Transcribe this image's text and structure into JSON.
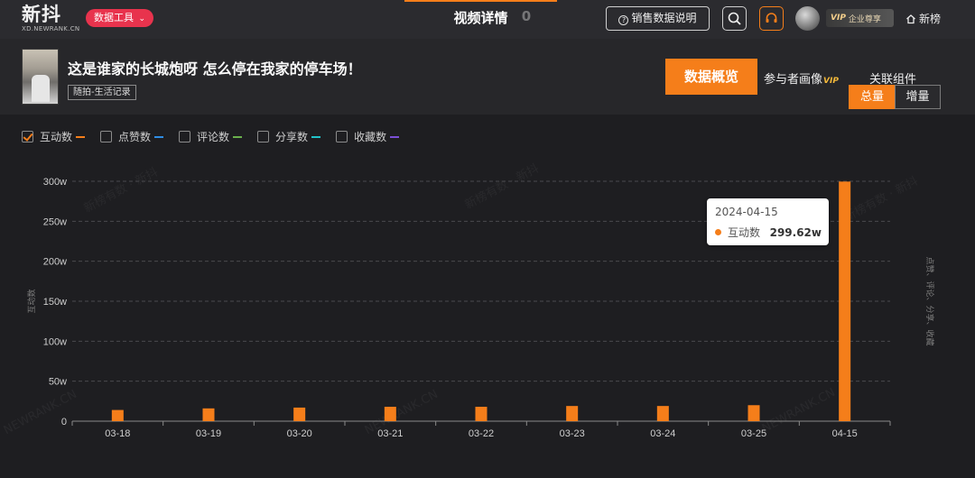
{
  "header": {
    "logo_main": "新抖",
    "logo_sub": "XD.NEWRANK.CN",
    "tools_label": "数据工具",
    "center_title": "视频详情",
    "center_ghost": "V  0",
    "explain_label": "销售数据说明",
    "vip_tag": "VIP",
    "vip_text": "企业尊享",
    "home_label": "新榜"
  },
  "video": {
    "title": "这是谁家的长城炮呀 怎么停在我家的停车场！",
    "tag": "随拍-生活记录",
    "overview_label": "数据概览",
    "persona_label": "参与者画像",
    "persona_vip": "VIP",
    "related_label": "关联组件",
    "seg_total": "总量",
    "seg_increment": "增量"
  },
  "legend": [
    {
      "label": "互动数",
      "checked": true,
      "color": "#f57e1a"
    },
    {
      "label": "点赞数",
      "checked": false,
      "color": "#2f8de4"
    },
    {
      "label": "评论数",
      "checked": false,
      "color": "#6ab04c"
    },
    {
      "label": "分享数",
      "checked": false,
      "color": "#22c3c9"
    },
    {
      "label": "收藏数",
      "checked": false,
      "color": "#7b4fd6"
    }
  ],
  "watermark": "新榜有数 · 新抖",
  "watermark_url": "NEWRANK.CN",
  "chart_data": {
    "type": "bar",
    "categories": [
      "03-18",
      "03-19",
      "03-20",
      "03-21",
      "03-22",
      "03-23",
      "03-24",
      "03-25",
      "04-15"
    ],
    "series": [
      {
        "name": "互动数",
        "values": [
          14,
          16,
          17,
          18,
          18,
          19,
          19,
          20,
          299.62
        ],
        "color": "#f57e1a"
      }
    ],
    "y_tick_labels": [
      "0",
      "50w",
      "100w",
      "150w",
      "200w",
      "250w",
      "300w"
    ],
    "ylim": [
      0,
      300
    ],
    "ylabel": "互动数",
    "y2label": "点赞、评论、分享、收藏",
    "grid": true,
    "tooltip": {
      "date": "2024-04-15",
      "label": "互动数",
      "value": "299.62w"
    }
  }
}
